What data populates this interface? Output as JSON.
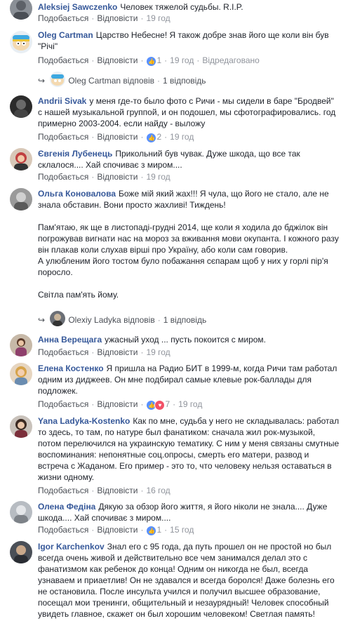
{
  "labels": {
    "like": "Подобається",
    "reply": "Відповісти",
    "edited": "Відредаговано",
    "replied": "відповів",
    "one_reply": "1 відповідь"
  },
  "comments": [
    {
      "name": "Aleksiej Sawczenko",
      "text": "Человек тяжелой судьбы. R.I.P.",
      "time": "19 год"
    },
    {
      "name": "Oleg Cartman",
      "text": "Царство Небесне! Я також добре знав його ще коли він був \"Річі\"",
      "likes": "1",
      "time": "19 год",
      "reply_by": "Oleg Cartman"
    },
    {
      "name": "Andrii Sivak",
      "text": "у меня где-то было фото с Ричи - мы сидели в баре \"Бродвей\" с нашей музыкальной группой, и он подошел, мы сфотографировались. год примерно 2003-2004. если найду - выложу",
      "likes": "2",
      "time": "19 год"
    },
    {
      "name": "Євгенія Лубенець",
      "text": "Прикольний був чувак. Дуже шкода, що все так склалося.... Хай спочиває з миром....",
      "time": "19 год"
    },
    {
      "name": "Ольга Коновалова",
      "text": "Боже мій який жах!!! Я чула, що його не стало, але не знала обставин. Вони просто жахливі! Тиждень!",
      "text2": "Пам'ятаю, як ще в листопаді-грудні 2014, ще коли я ходила до бджілок він погрожував вигнати нас на мороз за вживання мови окупанта. І кожного разу він плакав коли слухав вірші про Україну, або коли сам говорив.",
      "text3": "А улюбленим його тостом було побажання сєпарам щоб у них у горлі пір'я поросло.",
      "text4": "Світла пам'ять йому.",
      "reply_by": "Olexiy Ladyka"
    },
    {
      "name": "Анна Верещага",
      "text": "ужасный уход ... пусть покоится с миром.",
      "time": "19 год"
    },
    {
      "name": "Елена Костенко",
      "text": "Я пришла на Радио БИТ в 1999-м, когда Ричи там работал одним из диджеев. Он мне подбирал самые клевые рок-баллады для подложек.",
      "likes": "7",
      "time": "19 год"
    },
    {
      "name": "Yana Ladyka-Kostenko",
      "text": "Как по мне, судьба у него не складывалась: работал то здесь, то там, по натуре был фанатиком: сначала жил рок-музыкой, потом перелючился на украинскую тематику. С ним у меня связаны смутные воспоминания: непонятные соц.опросы, смерть его матери, развод и встреча с Жаданом. Его пример - это то, что человеку нельзя оставаться в жизни одному.",
      "time": "16 год"
    },
    {
      "name": "Олена Федіна",
      "text": "Дякую за обзор його життя, я його ніколи не знала.... Дуже шкода.... Хай спочиває з миром....",
      "likes": "1",
      "time": "15 год"
    },
    {
      "name": "Igor Karchenkov",
      "text": "Знал его с 95 года, да путь прошел он не простой но был всегда очень живой и действительно все чем занимался делал это с фанатизмом как ребенок до конца! Одним он никогда не был, всегда узнаваем и приаетлив! Он не здавался и всегда боролся! Даже болезнь его не остановила. После инсульта учился и получил высшее образование, посещал мои тренинги, общительный и незаурядный! Человек способный увидеть главное, скажет он был хорошим человеком! Светлая память!"
    }
  ]
}
